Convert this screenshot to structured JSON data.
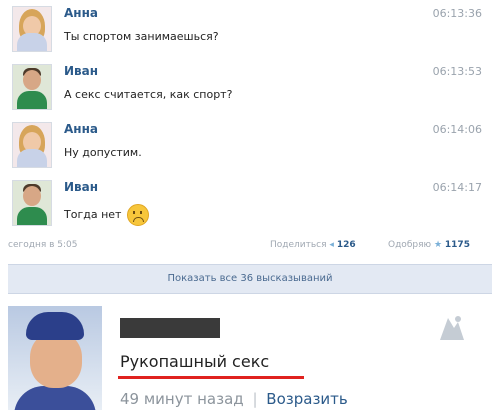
{
  "messages": [
    {
      "name": "Анна",
      "time": "06:13:36",
      "text": "Ты спортом занимаешься?"
    },
    {
      "name": "Иван",
      "time": "06:13:53",
      "text": "А секс считается, как спорт?"
    },
    {
      "name": "Анна",
      "time": "06:14:06",
      "text": "Ну допустим."
    },
    {
      "name": "Иван",
      "time": "06:14:17",
      "text": "Тогда нет"
    }
  ],
  "footer": {
    "date": "сегодня в 5:05",
    "share_label": "Поделиться",
    "share_count": "126",
    "agree_label": "Одобряю",
    "agree_count": "1175"
  },
  "show_all": "Показать все 36 высказываний",
  "status_card": {
    "status_text": "Рукопашный секс",
    "time_ago": "49 минут назад",
    "separator": "|",
    "reply_link": "Возразить"
  },
  "colors": {
    "name_link": "#2b5a8a",
    "underline": "#e0221f",
    "show_all_bg": "#e3e9f3"
  },
  "icons": {
    "sad_emoji": "sad-face-emoji-icon",
    "share_tick": "share-icon",
    "agree_tick": "star-icon",
    "logo": "watermark-logo"
  }
}
